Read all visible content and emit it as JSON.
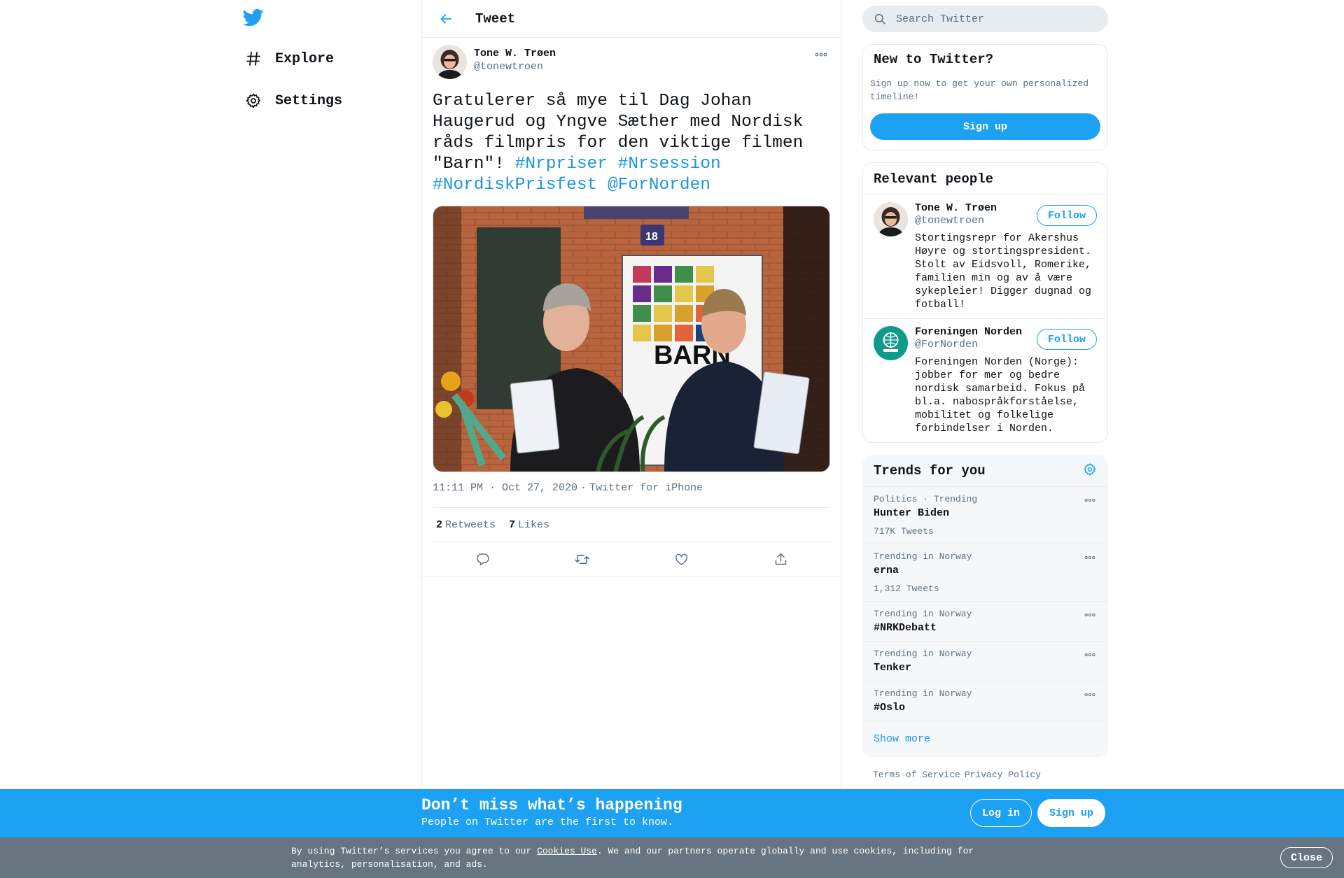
{
  "colors": {
    "brand": "#1da1f2",
    "link": "#1b95e0",
    "secondary_text": "#5b7083",
    "cookie_bar": "#66757f"
  },
  "nav": {
    "logo_icon": "twitter-bird-icon",
    "items": [
      {
        "label": "Explore",
        "icon": "hashtag-icon"
      },
      {
        "label": "Settings",
        "icon": "gear-icon"
      }
    ]
  },
  "header": {
    "title": "Tweet",
    "back_icon": "arrow-left-icon"
  },
  "tweet": {
    "author_name": "Tone W. Trøen",
    "author_handle": "@tonewtroen",
    "text_plain": "Gratulerer så mye til Dag Johan Haugerud og Yngve Sæther med Nordisk råds filmpris for den viktige filmen \"Barn\"! ",
    "links": [
      "#Nrpriser",
      "#Nrsession",
      "#NordiskPrisfest",
      "@ForNorden"
    ],
    "media_sign": "BARN",
    "media_number": "18",
    "time": "11:11 PM · Oct 27, 2020",
    "separator": "·",
    "source": "Twitter for iPhone",
    "retweets_count": "2",
    "retweets_label": "Retweets",
    "likes_count": "7",
    "likes_label": "Likes",
    "actions": [
      "reply-icon",
      "retweet-icon",
      "like-icon",
      "share-icon"
    ]
  },
  "search": {
    "placeholder": "Search Twitter"
  },
  "new_to_twitter": {
    "title": "New to Twitter?",
    "text": "Sign up now to get your own personalized timeline!",
    "button": "Sign up"
  },
  "relevant_people": {
    "title": "Relevant people",
    "people": [
      {
        "name": "Tone W. Trøen",
        "handle": "@tonewtroen",
        "bio": "Stortingsrepr for Akershus Høyre og stortingspresident. Stolt av Eidsvoll, Romerike, familien min og av å være sykepleier! Digger dugnad og fotball!",
        "button": "Follow"
      },
      {
        "name": "Foreningen Norden",
        "handle": "@ForNorden",
        "bio": "Foreningen Norden (Norge): jobber for mer og bedre nordisk samarbeid. Fokus på bl.a. nabospråkforståelse, mobilitet og folkelige forbindelser i Norden.",
        "button": "Follow"
      }
    ]
  },
  "trends": {
    "title": "Trends for you",
    "items": [
      {
        "context": "Politics · Trending",
        "name": "Hunter Biden",
        "count": "717K Tweets"
      },
      {
        "context": "Trending in Norway",
        "name": "erna",
        "count": "1,312 Tweets"
      },
      {
        "context": "Trending in Norway",
        "name": "#NRKDebatt",
        "count": ""
      },
      {
        "context": "Trending in Norway",
        "name": "Tenker",
        "count": ""
      },
      {
        "context": "Trending in Norway",
        "name": "#Oslo",
        "count": ""
      }
    ],
    "show_more": "Show more"
  },
  "footer": {
    "links": [
      "Terms of Service",
      "Privacy Policy"
    ]
  },
  "banner": {
    "title": "Don’t miss what’s happening",
    "subtitle": "People on Twitter are the first to know.",
    "login": "Log in",
    "signup": "Sign up"
  },
  "cookie": {
    "text_before": "By using Twitter’s services you agree to our ",
    "link": "Cookies Use",
    "text_after": ". We and our partners operate globally and use cookies, including for analytics, personalisation, and ads.",
    "close": "Close"
  }
}
